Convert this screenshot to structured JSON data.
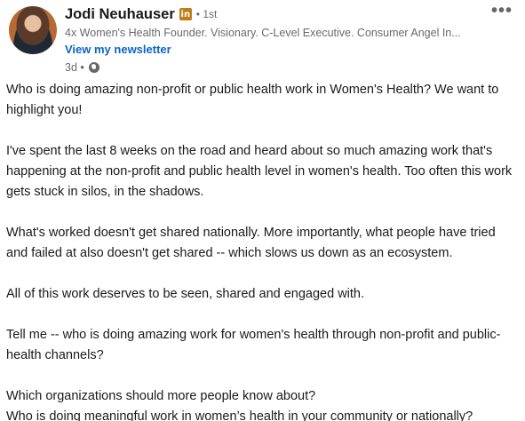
{
  "author": {
    "name": "Jodi Neuhauser",
    "badge": "in",
    "degree": "• 1st",
    "headline": "4x Women's Health Founder. Visionary. C-Level Executive. Consumer Angel In...",
    "newsletter_link": "View my newsletter",
    "time": "3d •",
    "visibility_icon": "globe-icon"
  },
  "menu": {
    "more_label": "•••"
  },
  "post": {
    "paragraphs": [
      "Who is doing amazing non-profit or public health work in Women's Health? We want to highlight you!",
      "I've spent the last 8 weeks on the road and heard about so much amazing work that's happening at the non-profit and public health level in women's health. Too often this work gets stuck in silos, in the shadows.",
      "What's worked doesn't get shared nationally. More importantly, what people have tried and failed at also doesn't get shared -- which slows us down as an ecosystem.",
      "All of this work deserves to be seen, shared and engaged with.",
      "Tell me -- who is doing amazing work for women's health through non-profit and public-health channels?",
      "Which organizations should more people know about?",
      "Who is doing meaningful work in women’s health in your community or nationally?"
    ]
  },
  "colors": {
    "link": "#0a66c2",
    "badge": "#c37d16",
    "text": "#000000e6",
    "muted": "#00000099"
  }
}
